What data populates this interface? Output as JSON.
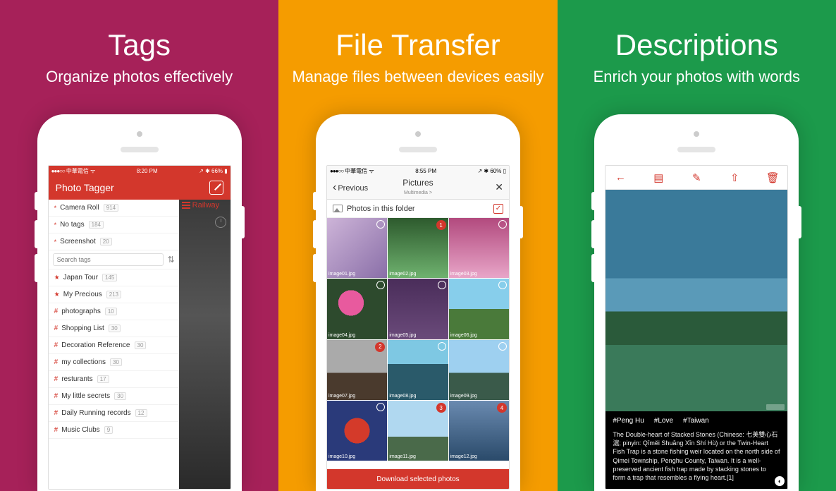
{
  "panels": [
    {
      "title": "Tags",
      "subtitle": "Organize photos effectively",
      "bg": "#a62159"
    },
    {
      "title": "File Transfer",
      "subtitle": "Manage files between devices easily",
      "bg": "#f59c00"
    },
    {
      "title": "Descriptions",
      "subtitle": "Enrich your photos with words",
      "bg": "#1c9a4b"
    }
  ],
  "screen1": {
    "carrier": "中華電信",
    "time": "8:20 PM",
    "battery": "66%",
    "app_title": "Photo Tagger",
    "breadcrumb": "Railway",
    "search_placeholder": "Search tags",
    "system_tags": [
      {
        "label": "Camera Roll",
        "count": "914"
      },
      {
        "label": "No tags",
        "count": "184"
      },
      {
        "label": "Screenshot",
        "count": "20"
      }
    ],
    "starred_tags": [
      {
        "label": "Japan Tour",
        "count": "145"
      },
      {
        "label": "My Precious",
        "count": "213"
      }
    ],
    "hash_tags": [
      {
        "label": "photographs",
        "count": "10"
      },
      {
        "label": "Shopping List",
        "count": "30"
      },
      {
        "label": "Decoration Reference",
        "count": "30"
      },
      {
        "label": "my collections",
        "count": "30"
      },
      {
        "label": "resturants",
        "count": "17"
      },
      {
        "label": "My little secrets",
        "count": "30"
      },
      {
        "label": "Daily Running records",
        "count": "12"
      },
      {
        "label": "Music Clubs",
        "count": "9"
      }
    ]
  },
  "screen2": {
    "carrier": "中華電信",
    "time": "8:55 PM",
    "battery": "60%",
    "back_label": "Previous",
    "title": "Pictures",
    "subtitle": "Multimedia >",
    "folder_label": "Photos in this folder",
    "download_label": "Download selected photos",
    "images": [
      {
        "name": "image01.jpg",
        "selected_order": null
      },
      {
        "name": "image02.jpg",
        "selected_order": 1
      },
      {
        "name": "image03.jpg",
        "selected_order": null
      },
      {
        "name": "image04.jpg",
        "selected_order": null
      },
      {
        "name": "image05.jpg",
        "selected_order": null
      },
      {
        "name": "image06.jpg",
        "selected_order": null
      },
      {
        "name": "image07.jpg",
        "selected_order": 2
      },
      {
        "name": "image08.jpg",
        "selected_order": null
      },
      {
        "name": "image09.jpg",
        "selected_order": null
      },
      {
        "name": "image10.jpg",
        "selected_order": null
      },
      {
        "name": "image11.jpg",
        "selected_order": 3
      },
      {
        "name": "image12.jpg",
        "selected_order": 4
      }
    ]
  },
  "screen3": {
    "tags": [
      "#Peng Hu",
      "#Love",
      "#Taiwan"
    ],
    "description": "The Double-heart of Stacked Stones (Chinese: 七美雙心石滬; pinyin: Qīměi Shuāng Xīn Shí Hù) or the Twin-Heart Fish Trap is a stone fishing weir located on the north side of Qimei Township, Penghu County, Taiwan. It is a well-preserved ancient fish trap made by stacking stones to form a trap that resembles a flying heart.[1]",
    "toolbar_icons": [
      "back-icon",
      "layout-icon",
      "edit-icon",
      "share-icon",
      "trash-icon"
    ]
  }
}
